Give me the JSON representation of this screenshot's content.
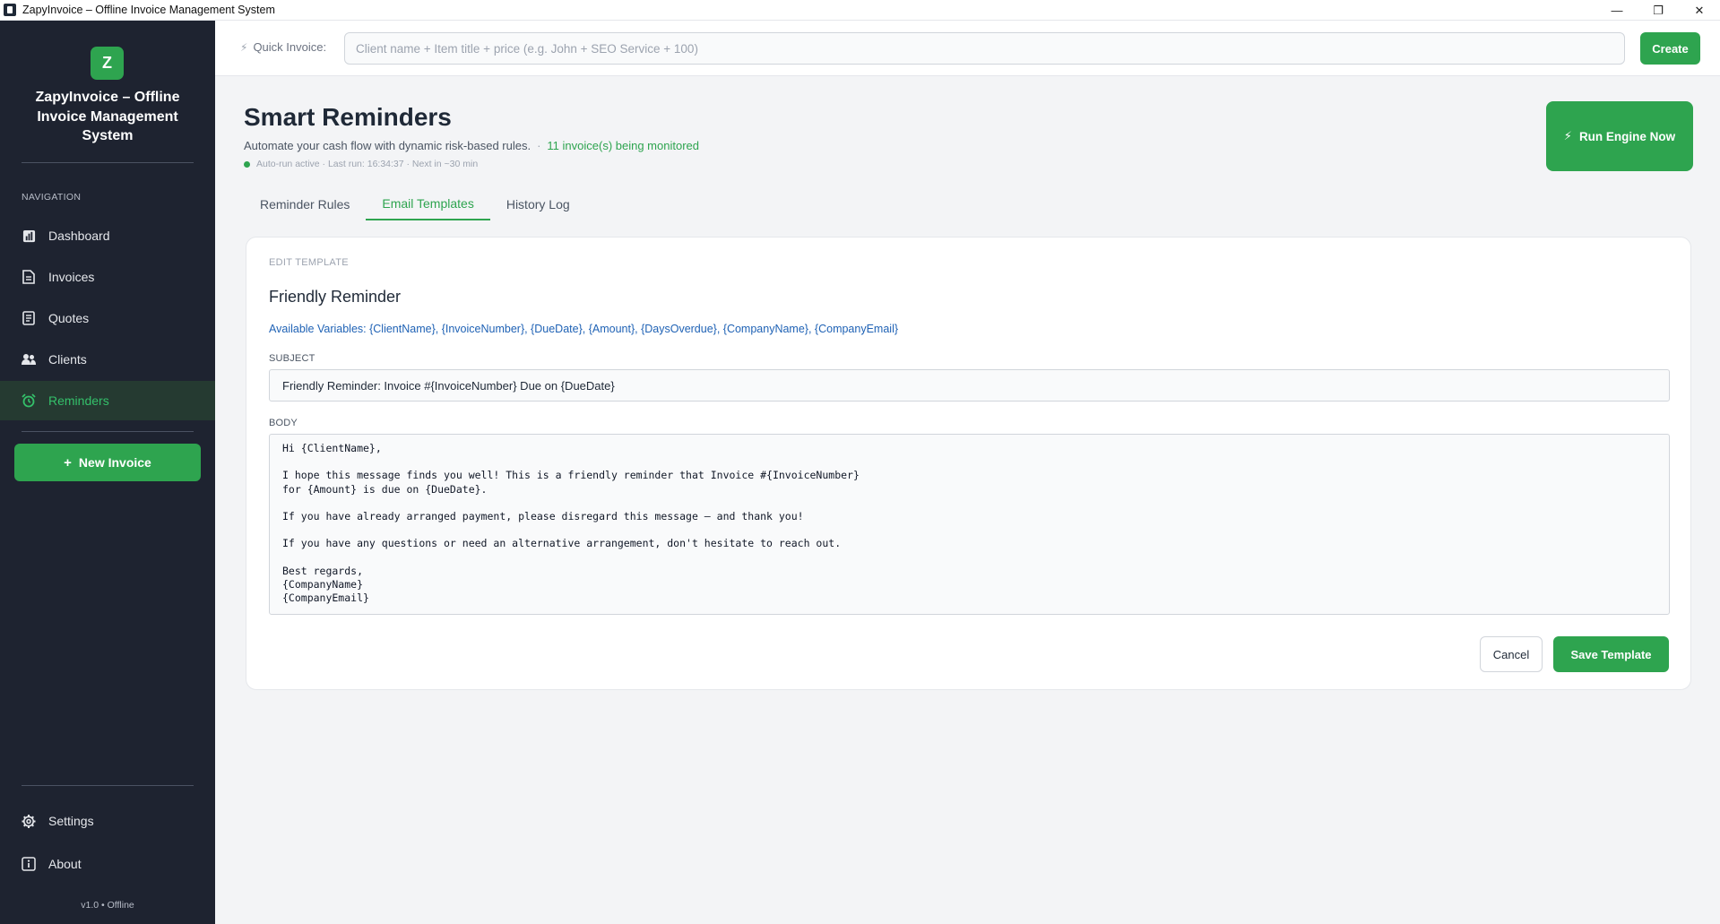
{
  "window": {
    "title": "ZapyInvoice – Offline Invoice Management System",
    "minimize_glyph": "—",
    "restore_glyph": "❐",
    "close_glyph": "✕"
  },
  "sidebar": {
    "logo_letter": "Z",
    "brand_name": "ZapyInvoice – Offline Invoice Management System",
    "nav_heading": "NAVIGATION",
    "items": [
      {
        "label": "Dashboard",
        "icon": "chart-icon"
      },
      {
        "label": "Invoices",
        "icon": "document-icon"
      },
      {
        "label": "Quotes",
        "icon": "receipt-icon"
      },
      {
        "label": "Clients",
        "icon": "users-icon"
      },
      {
        "label": "Reminders",
        "icon": "alarm-clock-icon",
        "active": true
      }
    ],
    "new_invoice_label": "New Invoice",
    "footer_items": [
      {
        "label": "Settings",
        "icon": "gear-icon"
      },
      {
        "label": "About",
        "icon": "info-icon"
      }
    ],
    "version": "v1.0 • Offline"
  },
  "topbar": {
    "quick_invoice_label": "Quick Invoice:",
    "quick_invoice_placeholder": "Client name + Item title + price (e.g. John + SEO Service + 100)",
    "create_label": "Create"
  },
  "header": {
    "title": "Smart Reminders",
    "subtitle": "Automate your cash flow with dynamic risk-based rules.",
    "separator": "·",
    "monitored": "11 invoice(s) being monitored",
    "status": "Auto-run active · Last run: 16:34:37 · Next in ~30 min",
    "run_button": "Run Engine Now"
  },
  "tabs": [
    {
      "label": "Reminder Rules",
      "active": false
    },
    {
      "label": "Email Templates",
      "active": true
    },
    {
      "label": "History Log",
      "active": false
    }
  ],
  "editor": {
    "eyebrow": "EDIT TEMPLATE",
    "template_name": "Friendly Reminder",
    "variables": "Available Variables: {ClientName}, {InvoiceNumber}, {DueDate}, {Amount}, {DaysOverdue}, {CompanyName}, {CompanyEmail}",
    "subject_label": "SUBJECT",
    "subject_value": "Friendly Reminder: Invoice #{InvoiceNumber} Due on {DueDate}",
    "body_label": "BODY",
    "body_value": "Hi {ClientName},\n\nI hope this message finds you well! This is a friendly reminder that Invoice #{InvoiceNumber}\nfor {Amount} is due on {DueDate}.\n\nIf you have already arranged payment, please disregard this message — and thank you!\n\nIf you have any questions or need an alternative arrangement, don't hesitate to reach out.\n\nBest regards,\n{CompanyName}\n{CompanyEmail}",
    "cancel_label": "Cancel",
    "save_label": "Save Template"
  },
  "colors": {
    "accent": "#2ea44f",
    "sidebar_bg": "#1e2330",
    "link": "#1f62b5"
  }
}
